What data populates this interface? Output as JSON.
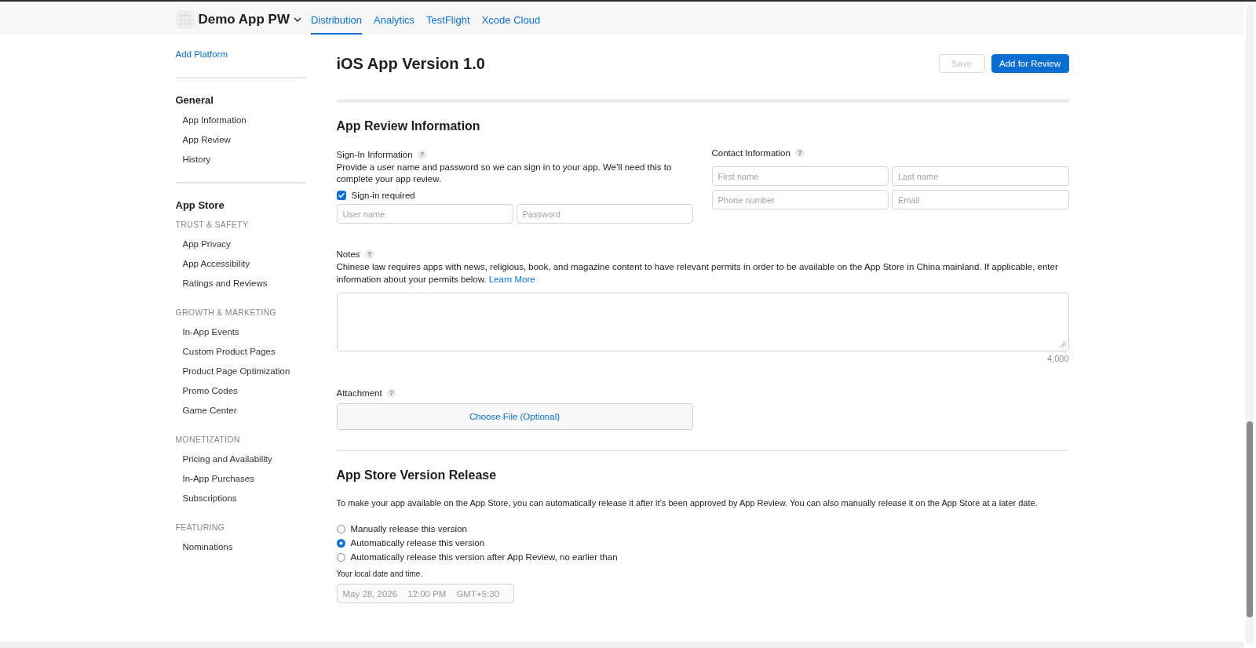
{
  "header": {
    "app_name": "Demo App PW",
    "tabs": [
      {
        "label": "Distribution",
        "selected": true
      },
      {
        "label": "Analytics",
        "selected": false
      },
      {
        "label": "TestFlight",
        "selected": false
      },
      {
        "label": "Xcode Cloud",
        "selected": false
      }
    ]
  },
  "sidebar": {
    "add_platform": "Add Platform",
    "sections": [
      {
        "title": "General",
        "groups": [
          {
            "items": [
              {
                "label": "App Information",
                "selected": false
              },
              {
                "label": "App Review",
                "selected": false
              },
              {
                "label": "History",
                "selected": false
              }
            ]
          }
        ]
      },
      {
        "title": "App Store",
        "groups": [
          {
            "heading": "TRUST & SAFETY",
            "items": [
              {
                "label": "App Privacy",
                "selected": false
              },
              {
                "label": "App Accessibility",
                "selected": false
              },
              {
                "label": "Ratings and Reviews",
                "selected": false
              }
            ]
          },
          {
            "heading": "GROWTH & MARKETING",
            "items": [
              {
                "label": "In-App Events",
                "selected": false
              },
              {
                "label": "Custom Product Pages",
                "selected": false
              },
              {
                "label": "Product Page Optimization",
                "selected": false
              },
              {
                "label": "Promo Codes",
                "selected": false
              },
              {
                "label": "Game Center",
                "selected": false
              }
            ]
          },
          {
            "heading": "MONETIZATION",
            "items": [
              {
                "label": "Pricing and Availability",
                "selected": false
              },
              {
                "label": "In-App Purchases",
                "selected": false
              },
              {
                "label": "Subscriptions",
                "selected": false
              }
            ]
          },
          {
            "heading": "FEATURING",
            "items": [
              {
                "label": "Nominations",
                "selected": false
              }
            ]
          }
        ]
      }
    ]
  },
  "version": {
    "title": "iOS App Version 1.0",
    "buttons": [
      {
        "label": "Save",
        "kind": "secondary",
        "disabled": true
      },
      {
        "label": "Add for Review",
        "kind": "primary",
        "disabled": false
      }
    ]
  },
  "app_review_information": {
    "title": "App Review Information",
    "sign_in": {
      "label": "Sign-In Information",
      "help": "?",
      "description": "Provide a user name and password so we can sign in to your app. We’ll need this to complete your app review.",
      "checkbox": {
        "label": "Sign-in required",
        "checked": true
      },
      "fields": [
        {
          "placeholder": "User name"
        },
        {
          "placeholder": "Password"
        }
      ]
    },
    "contact": {
      "label": "Contact Information",
      "help": "?",
      "fields": [
        {
          "placeholder": "First name"
        },
        {
          "placeholder": "Last name"
        },
        {
          "placeholder": "Phone number"
        },
        {
          "placeholder": "Email"
        }
      ]
    },
    "notes": {
      "label": "Notes",
      "help": "?",
      "description": "Chinese law requires apps with news, religious, book, and magazine content to have relevant permits in order to be available on the App Store in China mainland. If applicable, enter information about your permits below.",
      "link": "Learn More",
      "counter": "4,000"
    },
    "attachment": {
      "label": "Attachment",
      "help": "?",
      "button": "Choose File (Optional)"
    }
  },
  "version_release": {
    "title": "App Store Version Release",
    "description": "To make your app available on the App Store, you can automatically release it after it’s been approved by App Review. You can also manually release it on the App Store at a later date.",
    "options": [
      {
        "label": "Manually release this version",
        "selected": false
      },
      {
        "label": "Automatically release this version",
        "selected": true
      },
      {
        "label": "Automatically release this version after App Review, no earlier than",
        "selected": false
      }
    ],
    "date_hint": "Your local date and time.",
    "date_field": {
      "date": "May 28, 2026",
      "time": "12:00 PM",
      "timezone": "GMT+5:30",
      "disabled": true
    }
  }
}
